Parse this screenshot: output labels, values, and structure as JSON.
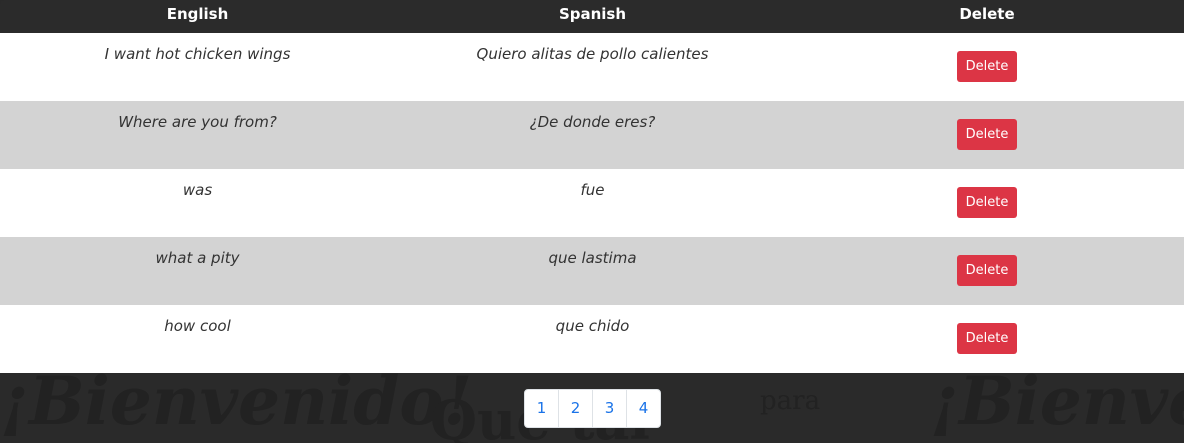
{
  "background": {
    "words": [
      "¡Bienvenido!",
      "Que tal",
      "para",
      "¡Bienve"
    ]
  },
  "table": {
    "headers": {
      "english": "English",
      "spanish": "Spanish",
      "delete": "Delete"
    },
    "rows": [
      {
        "english": "I want hot chicken wings",
        "spanish": "Quiero alitas de pollo calientes",
        "delete_label": "Delete"
      },
      {
        "english": "Where are you from?",
        "spanish": "¿De donde eres?",
        "delete_label": "Delete"
      },
      {
        "english": "was",
        "spanish": "fue",
        "delete_label": "Delete"
      },
      {
        "english": "what a pity",
        "spanish": "que lastima",
        "delete_label": "Delete"
      },
      {
        "english": "how cool",
        "spanish": "que chido",
        "delete_label": "Delete"
      }
    ]
  },
  "pagination": {
    "pages": [
      "1",
      "2",
      "3",
      "4"
    ]
  },
  "colors": {
    "header_bg": "#2b2b2b",
    "row_alt_bg": "#d3d3d3",
    "delete_button": "#dc3545",
    "page_link": "#1a73e8"
  }
}
